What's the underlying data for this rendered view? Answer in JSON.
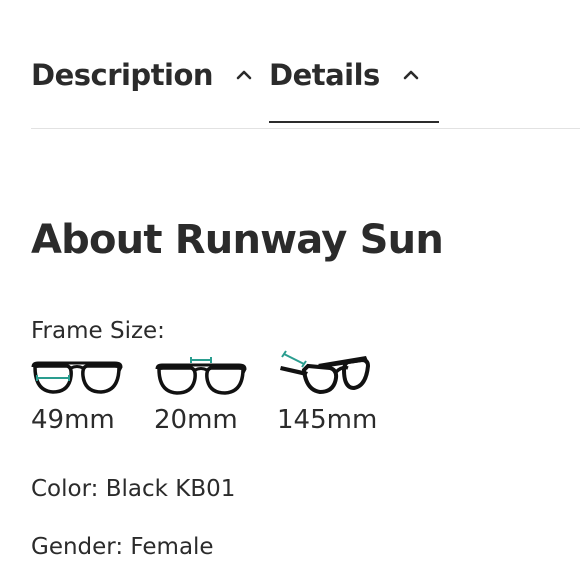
{
  "tabs": [
    {
      "label": "Description",
      "icon": "chevron-up-icon"
    },
    {
      "label": "Details",
      "icon": "chevron-up-icon"
    }
  ],
  "active_tab": "Details",
  "details": {
    "title": "About Runway Sun",
    "frame_size_label": "Frame Size:",
    "measurements": [
      {
        "value": "49mm",
        "icon": "lens-width-icon"
      },
      {
        "value": "20mm",
        "icon": "bridge-width-icon"
      },
      {
        "value": "145mm",
        "icon": "temple-length-icon"
      }
    ],
    "color": "Color: Black KB01",
    "gender": "Gender: Female"
  },
  "colors": {
    "text": "#2b2b2b",
    "accent": "#2a9d8f",
    "divider": "#e2e2e2"
  }
}
